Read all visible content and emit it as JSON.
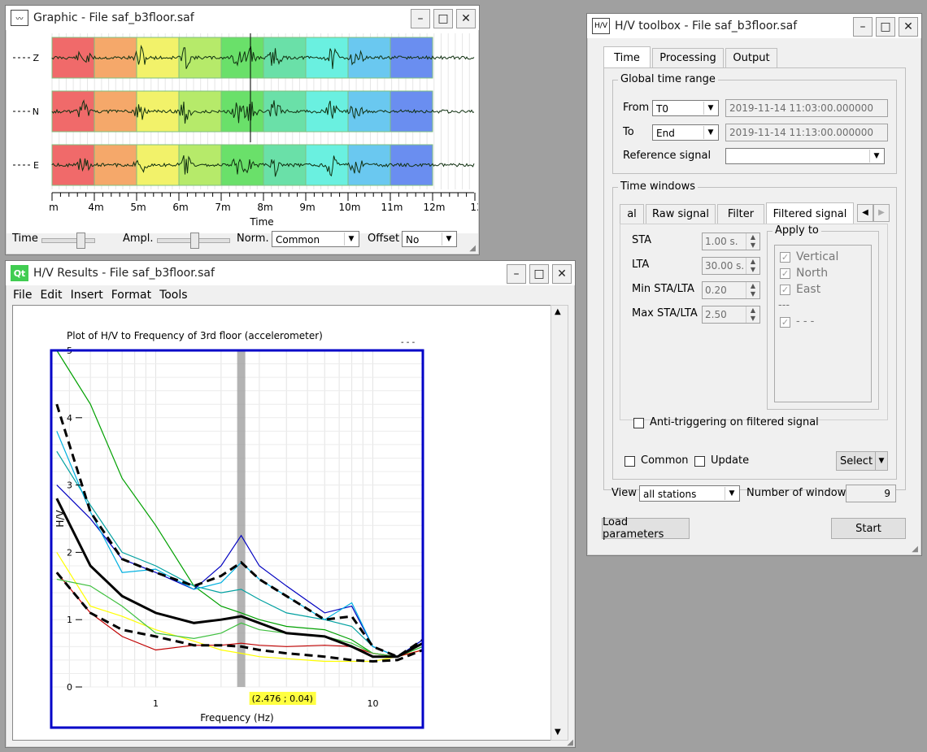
{
  "graphic": {
    "title": "Graphic - File saf_b3floor.saf",
    "channels": [
      "Z",
      "N",
      "E"
    ],
    "time_ticks": [
      "m",
      "4m",
      "5m",
      "6m",
      "7m",
      "8m",
      "9m",
      "10m",
      "11m",
      "12m",
      "13"
    ],
    "xlabel": "Time",
    "controls": {
      "time_label": "Time",
      "ampl_label": "Ampl.",
      "norm_label": "Norm.",
      "norm_value": "Common",
      "offset_label": "Offset",
      "offset_value": "No"
    },
    "window_colors": [
      "#f06a6a",
      "#f5a86a",
      "#f2f26a",
      "#b6ea6a",
      "#6ae06a",
      "#6ae0a8",
      "#6af0e0",
      "#6ac8f0",
      "#6a8ef0"
    ]
  },
  "results": {
    "title": "H/V Results - File saf_b3floor.saf",
    "menu": [
      "File",
      "Edit",
      "Insert",
      "Format",
      "Tools"
    ],
    "dots": "- - -",
    "chart_data": {
      "type": "line",
      "title": "Plot of H/V to Frequency of 3rd floor (accelerometer)",
      "xlabel": "Frequency (Hz)",
      "ylabel": "H/V",
      "xscale": "log",
      "xlim": [
        0.33,
        17
      ],
      "ylim": [
        0,
        5
      ],
      "x_ticks": [
        "1",
        "10"
      ],
      "y_ticks": [
        "0",
        "1",
        "2",
        "3",
        "4",
        "5"
      ],
      "peak_frequency": 2.476,
      "cursor_readout": "(2.476 ; 0.04)",
      "x": [
        0.35,
        0.5,
        0.7,
        1.0,
        1.5,
        2.0,
        2.476,
        3.0,
        4.0,
        6.0,
        8.0,
        10.0,
        13.0,
        17.0
      ],
      "series": [
        {
          "color": "#ffff00",
          "values": [
            2.0,
            1.2,
            1.05,
            0.85,
            0.68,
            0.55,
            0.5,
            0.45,
            0.42,
            0.38,
            0.38,
            0.38,
            0.45,
            0.55
          ]
        },
        {
          "color": "#00a000",
          "values": [
            5.0,
            4.2,
            3.1,
            2.4,
            1.5,
            1.2,
            1.1,
            1.0,
            0.9,
            0.85,
            0.7,
            0.5,
            0.45,
            0.6
          ]
        },
        {
          "color": "#00a0a0",
          "values": [
            3.5,
            2.7,
            2.0,
            1.8,
            1.5,
            1.4,
            1.45,
            1.3,
            1.1,
            1.0,
            0.9,
            0.6,
            0.45,
            0.7
          ]
        },
        {
          "color": "#0000c0",
          "values": [
            3.0,
            2.5,
            1.9,
            1.7,
            1.45,
            1.8,
            2.25,
            1.8,
            1.5,
            1.1,
            1.2,
            0.6,
            0.45,
            0.7
          ]
        },
        {
          "color": "#00b0e0",
          "values": [
            3.8,
            2.6,
            1.7,
            1.75,
            1.45,
            1.55,
            1.85,
            1.6,
            1.35,
            1.0,
            1.25,
            0.6,
            0.45,
            0.65
          ]
        },
        {
          "color": "#c00000",
          "values": [
            1.7,
            1.1,
            0.75,
            0.55,
            0.62,
            0.62,
            0.65,
            0.62,
            0.6,
            0.62,
            0.6,
            0.5,
            0.45,
            0.55
          ]
        },
        {
          "color": "#40c040",
          "values": [
            1.6,
            1.5,
            1.2,
            0.8,
            0.72,
            0.8,
            0.95,
            0.85,
            0.8,
            0.75,
            0.65,
            0.5,
            0.45,
            0.6
          ]
        },
        {
          "color": "#000000",
          "values": [
            2.8,
            1.8,
            1.35,
            1.1,
            0.95,
            1.0,
            1.05,
            0.95,
            0.8,
            0.75,
            0.6,
            0.45,
            0.45,
            0.65
          ]
        },
        {
          "color": "#000000",
          "dash": true,
          "values": [
            4.2,
            2.6,
            1.9,
            1.7,
            1.5,
            1.65,
            1.85,
            1.6,
            1.35,
            1.0,
            1.05,
            0.6,
            0.45,
            0.7
          ]
        },
        {
          "color": "#000000",
          "dash": true,
          "values": [
            1.7,
            1.1,
            0.85,
            0.75,
            0.62,
            0.62,
            0.6,
            0.55,
            0.5,
            0.45,
            0.4,
            0.38,
            0.4,
            0.55
          ]
        }
      ]
    }
  },
  "toolbox": {
    "title": "H/V toolbox - File saf_b3floor.saf",
    "tabs": [
      "Time",
      "Processing",
      "Output"
    ],
    "global_range": {
      "title": "Global time range",
      "from_label": "From",
      "from_value": "T0",
      "from_time": "2019-11-14 11:03:00.000000",
      "to_label": "To",
      "to_value": "End",
      "to_time": "2019-11-14 11:13:00.000000",
      "ref_label": "Reference signal",
      "ref_value": ""
    },
    "time_windows": {
      "title": "Time windows",
      "subtabs": [
        "al",
        "Raw signal",
        "Filter",
        "Filtered signal"
      ],
      "sta_label": "STA",
      "sta_value": "1.00 s.",
      "lta_label": "LTA",
      "lta_value": "30.00 s.",
      "min_label": "Min STA/LTA",
      "min_value": "0.20",
      "max_label": "Max STA/LTA",
      "max_value": "2.50",
      "apply_title": "Apply to",
      "apply_items": [
        "Vertical",
        "North",
        "East"
      ],
      "apply_sep": "---",
      "apply_extra": "- - -",
      "anti_label": "Anti-triggering on filtered signal",
      "common_label": "Common",
      "update_label": "Update",
      "select_label": "Select"
    },
    "view_label": "View",
    "view_value": "all stations",
    "nwin_label": "Number of windows",
    "nwin_value": "9",
    "load_label": "Load parameters",
    "start_label": "Start"
  }
}
